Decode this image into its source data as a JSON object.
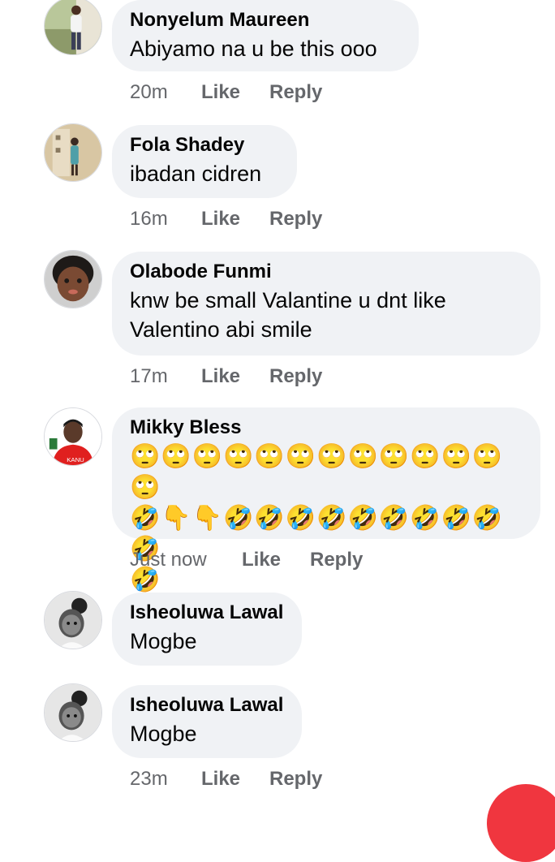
{
  "colors": {
    "bubble": "#f0f2f5",
    "meta": "#65676b",
    "fab": "#f0363f"
  },
  "comments": [
    {
      "name": "Nonyelum Maureen",
      "text": "Abiyamo na u be this ooo",
      "time": "20m",
      "like": "Like",
      "reply": "Reply",
      "avatar": "woman-standing-avatar"
    },
    {
      "name": "Fola Shadey",
      "text": "ibadan cidren",
      "time": "16m",
      "like": "Like",
      "reply": "Reply",
      "avatar": "child-outdoors-avatar"
    },
    {
      "name": "Olabode Funmi",
      "text": "knw be small Valantine u dnt like\nValentino abi smile",
      "time": "17m",
      "like": "Like",
      "reply": "Reply",
      "avatar": "baby-face-avatar"
    },
    {
      "name": "Mikky Bless",
      "emoji_rows": [
        "🙄🙄🙄🙄🙄🙄🙄🙄🙄🙄🙄🙄🙄",
        "🤣👇👇🤣🤣🤣🤣🤣🤣🤣🤣🤣🤣",
        "🤣"
      ],
      "time": "Just now",
      "like": "Like",
      "reply": "Reply",
      "avatar": "man-red-shirt-avatar",
      "avatar_text": "KANU"
    },
    {
      "name": "Isheoluwa Lawal",
      "text": "Mogbe",
      "avatar": "girl-bw-avatar"
    },
    {
      "name": "Isheoluwa Lawal",
      "text": "Mogbe",
      "time": "23m",
      "like": "Like",
      "reply": "Reply",
      "avatar": "girl-bw-avatar"
    }
  ]
}
